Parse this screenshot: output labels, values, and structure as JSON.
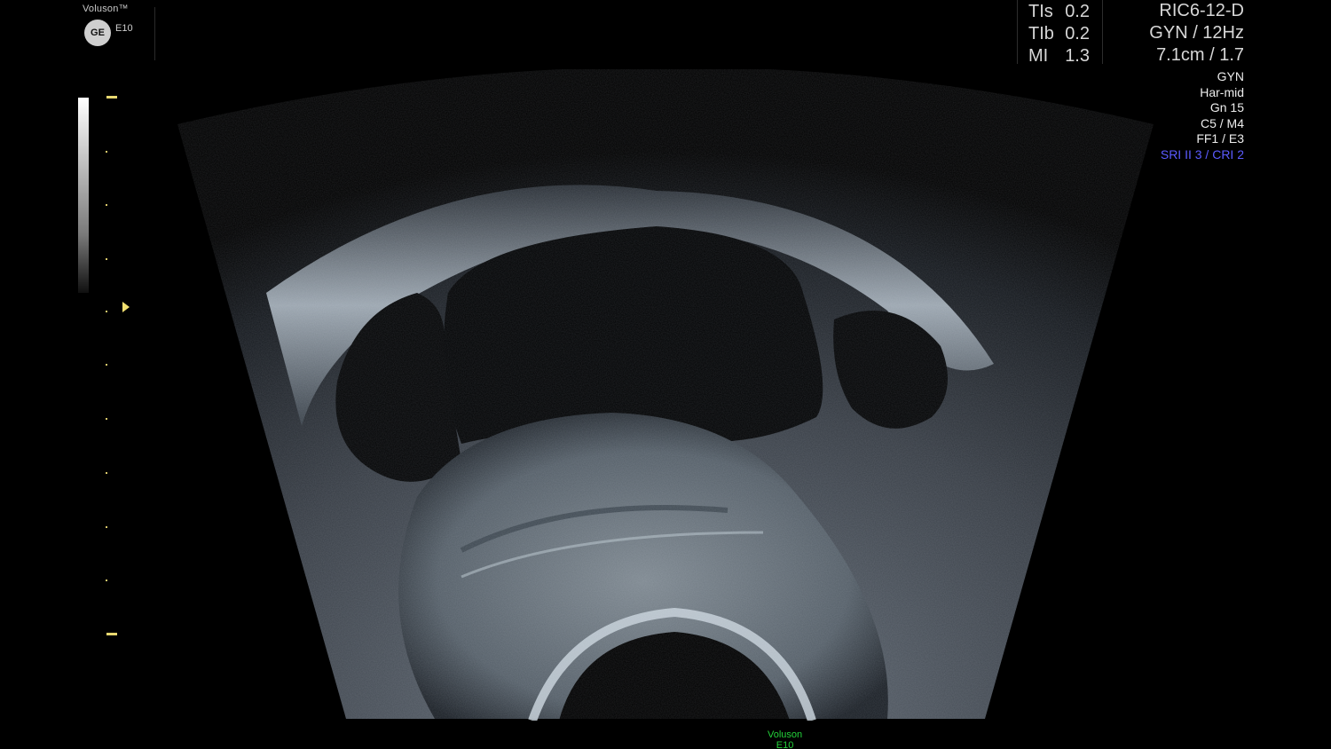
{
  "header": {
    "brand": "Voluson™",
    "logo_text": "GE",
    "model_badge": "E10"
  },
  "safety": {
    "tis_label": "TIs",
    "tis_value": "0.2",
    "tib_label": "TIb",
    "tib_value": "0.2",
    "mi_label": "MI",
    "mi_value": "1.3"
  },
  "probe": {
    "line1": "RIC6-12-D",
    "line2": "GYN / 12Hz",
    "line3": "7.1cm / 1.7"
  },
  "params": {
    "p1": "GYN",
    "p2": "Har-mid",
    "p3": "Gn  15",
    "p4": "C5 / M4",
    "p5": "FF1 / E3",
    "p6": "SRI II 3 / CRI 2",
    "accent_color": "#5b5bff"
  },
  "bottom": {
    "brand": "Voluson",
    "model": "E10",
    "color": "#23d23a"
  },
  "icons": {
    "logo": "ge-logo-icon",
    "focus": "focus-marker-icon"
  }
}
